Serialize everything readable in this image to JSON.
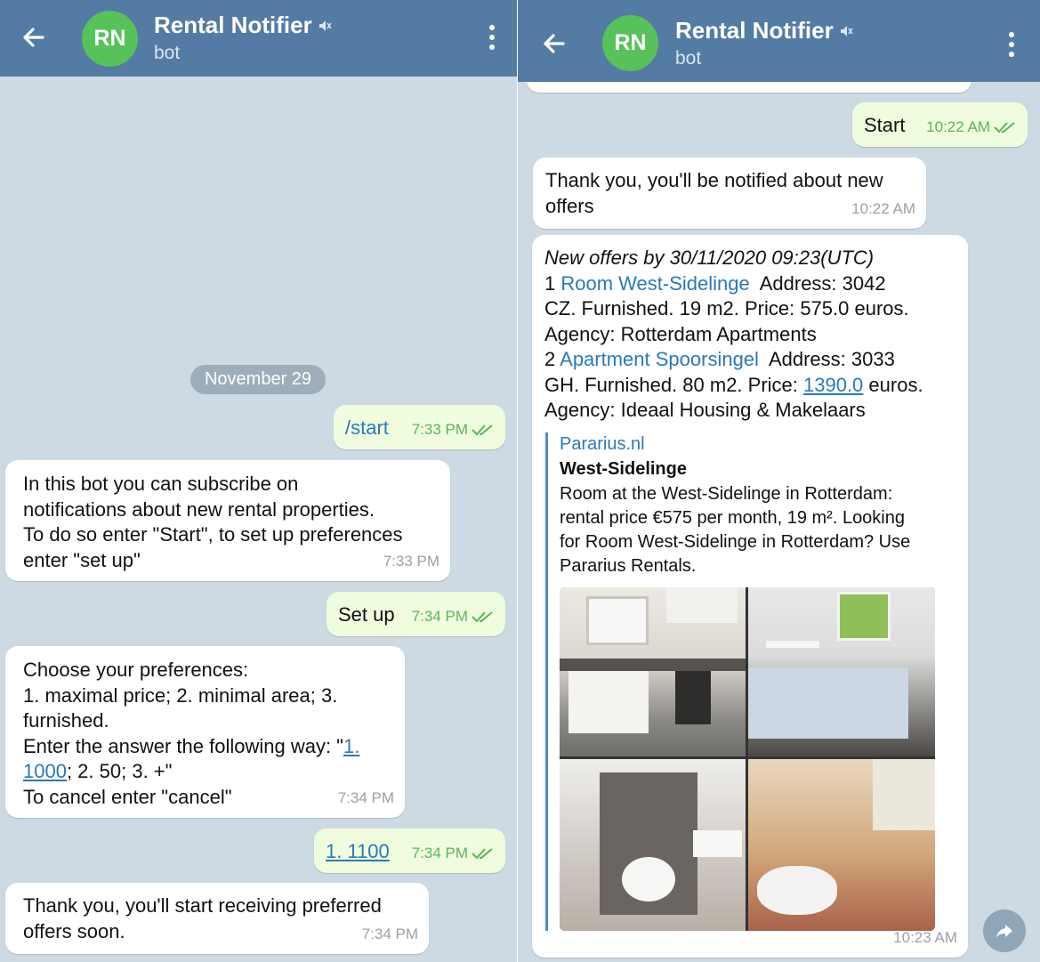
{
  "chat": {
    "initials": "RN",
    "title": "Rental Notifier",
    "subtitle": "bot"
  },
  "left_pane": {
    "date_separator": "November 29",
    "messages": [
      {
        "side": "out",
        "text": "/start",
        "time": "7:33 PM"
      },
      {
        "side": "in",
        "text": "In this bot you can subscribe on\nnotifications about new rental properties.\nTo do so enter \"Start\", to set up preferences\nenter \"set up\"",
        "time": "7:33 PM"
      },
      {
        "side": "out",
        "text": "Set up",
        "time": "7:34 PM"
      },
      {
        "side": "in",
        "line1": "Choose your preferences:",
        "line2": "1. maximal price; 2. minimal area; 3.",
        "line3": "furnished.",
        "line4_pre": "Enter the answer the following way: \"",
        "line4_link": "1.",
        "line5_link": "1000",
        "line5_post": "; 2. 50; 3. +\"",
        "line6": "To cancel enter \"cancel\"",
        "time": "7:34 PM"
      },
      {
        "side": "out",
        "text": "1. 1100",
        "time": "7:34 PM"
      },
      {
        "side": "in",
        "text": "Thank you, you'll start receiving preferred\noffers soon.",
        "time": "7:34 PM"
      }
    ]
  },
  "right_pane": {
    "messages": [
      {
        "side": "out",
        "text": "Start",
        "time": "10:22 AM"
      },
      {
        "side": "in",
        "text": "Thank you, you'll be notified about new\noffers",
        "time": "10:22 AM"
      },
      {
        "side": "in",
        "heading": "New offers by 30/11/2020 09:23(UTC)",
        "offer1_num": "1 ",
        "offer1_link": "Room West-Sidelinge",
        "offer1_rest_a": "  Address: 3042",
        "offer1_rest_b": "CZ. Furnished. 19 m2. Price: 575.0 euros.",
        "offer1_rest_c": "Agency: Rotterdam Apartments",
        "offer2_num": "2 ",
        "offer2_link": "Apartment Spoorsingel",
        "offer2_rest_a": "  Address: 3033",
        "offer2_rest_b_pre": "GH. Furnished. 80 m2. Price: ",
        "offer2_price_link": "1390.0",
        "offer2_rest_b_post": " euros.",
        "offer2_rest_c": "Agency: Ideaal Housing & Makelaars",
        "preview": {
          "site": "Pararius.nl",
          "title": "West-Sidelinge",
          "description": "Room at the West-Sidelinge in Rotterdam:\nrental price €575 per month, 19 m². Looking\nfor Room West-Sidelinge in Rotterdam? Use\nPararius Rentals."
        },
        "time": "10:23 AM"
      }
    ]
  },
  "colors": {
    "header": "#537ba4",
    "avatar": "#57c259",
    "chat_background": "#cdd9e3",
    "incoming_bubble": "#ffffff",
    "outgoing_bubble": "#effdde",
    "link": "#2a79b8",
    "read_check": "#5db35a"
  },
  "icons": [
    "back-arrow-icon",
    "muted-icon",
    "more-options-icon",
    "double-check-icon",
    "forward-icon"
  ]
}
